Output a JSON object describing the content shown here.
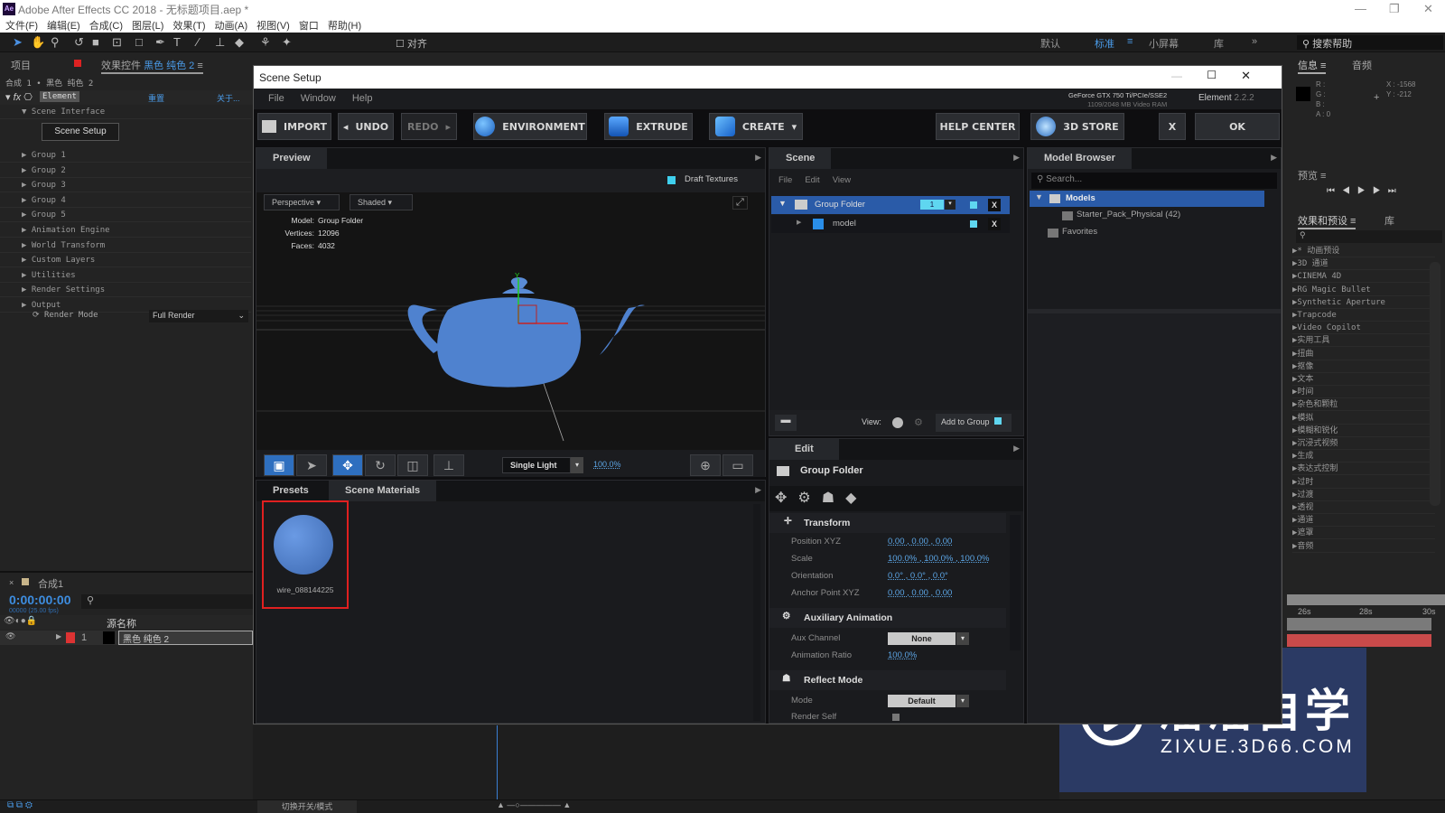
{
  "app": {
    "title": "Adobe After Effects CC 2018 - 无标题项目.aep *",
    "icon_text": "Ae",
    "menu": [
      "文件(F)",
      "编辑(E)",
      "合成(C)",
      "图层(L)",
      "效果(T)",
      "动画(A)",
      "视图(V)",
      "窗口",
      "帮助(H)"
    ],
    "snap_label": "对齐",
    "workspaces": [
      "默认",
      "标准",
      "小屏幕",
      "库"
    ],
    "active_workspace": "标准",
    "help_search": "搜索帮助"
  },
  "left": {
    "tab_project": "项目",
    "tab_effects": "效果控件",
    "layer_name": "黑色 纯色 2",
    "breadcrumb": "合成 1 • 黑色 纯色 2",
    "effect_name": "Element",
    "reset": "重置",
    "about": "关于...",
    "scene_interface": "Scene Interface",
    "scene_setup_btn": "Scene Setup",
    "groups": [
      "Group 1",
      "Group 2",
      "Group 3",
      "Group 4",
      "Group 5",
      "Animation Engine",
      "World Transform",
      "Custom Layers",
      "Utilities",
      "Render Settings",
      "Output"
    ],
    "render_mode_label": "Render Mode",
    "render_mode_value": "Full Render"
  },
  "timeline": {
    "comp": "合成1",
    "timecode": "0:00:00:00",
    "fps": "00000 (25.00 fps)",
    "col_source": "源名称",
    "layer_num": "1",
    "layer_name": "黑色 纯色 2",
    "toggle_label": "切换开关/模式"
  },
  "dialog": {
    "title": "Scene Setup",
    "menu": [
      "File",
      "Window",
      "Help"
    ],
    "gpu": "GeForce GTX 750 Ti/PCIe/SSE2",
    "vram": "1109/2048 MB Video RAM",
    "element": "Element",
    "version": "2.2.2",
    "toolbar": {
      "import": "IMPORT",
      "undo": "UNDO",
      "redo": "REDO",
      "environment": "ENVIRONMENT",
      "extrude": "EXTRUDE",
      "create": "CREATE",
      "help": "HELP CENTER",
      "store": "3D STORE",
      "x": "X",
      "ok": "OK"
    },
    "preview": {
      "tab": "Preview",
      "draft": "Draft Textures",
      "view": "Perspective",
      "shading": "Shaded",
      "model_label": "Model:",
      "model": "Group Folder",
      "vert_label": "Vertices:",
      "vertices": "12096",
      "faces_label": "Faces:",
      "faces": "4032",
      "light": "Single Light",
      "zoom": "100.0%"
    },
    "presets": {
      "tab1": "Presets",
      "tab2": "Scene Materials",
      "material": "wire_088144225"
    },
    "scene": {
      "tab": "Scene",
      "menu": [
        "File",
        "Edit",
        "View"
      ],
      "group": "Group Folder",
      "group_num": "1",
      "model": "model",
      "view_label": "View:",
      "add_group": "Add to Group"
    },
    "edit": {
      "tab": "Edit",
      "title": "Group Folder",
      "transform": "Transform",
      "rows": [
        {
          "label": "Position XYZ",
          "value": "0.00 ,  0.00 ,  0.00"
        },
        {
          "label": "Scale",
          "value": "100.0% ,  100.0% ,  100.0%"
        },
        {
          "label": "Orientation",
          "value": "0.0° ,  0.0° ,  0.0°"
        },
        {
          "label": "Anchor Point XYZ",
          "value": "0.00 ,  0.00 ,  0.00"
        }
      ],
      "aux": "Auxiliary Animation",
      "aux_channel": "Aux Channel",
      "aux_value": "None",
      "anim_ratio": "Animation Ratio",
      "anim_ratio_value": "100.0%",
      "reflect": "Reflect Mode",
      "mode": "Mode",
      "mode_value": "Default",
      "render_self": "Render Self"
    },
    "browser": {
      "tab": "Model Browser",
      "search_placeholder": "Search...",
      "models": "Models",
      "pack": "Starter_Pack_Physical (42)",
      "favorites": "Favorites"
    }
  },
  "right": {
    "info": "信息",
    "audio": "音频",
    "r": "R :",
    "g": "G :",
    "b": "B :",
    "a": "A : 0",
    "x": "X : -1568",
    "y": "Y : -212",
    "preview": "预览",
    "effects": "效果和预设",
    "library": "库",
    "fx": [
      "* 动画预设",
      "3D 通道",
      "CINEMA 4D",
      "RG Magic Bullet",
      "Synthetic Aperture",
      "Trapcode",
      "Video Copilot",
      "实用工具",
      "扭曲",
      "抠像",
      "文本",
      "时间",
      "杂色和颗粒",
      "模拟",
      "模糊和锐化",
      "沉浸式视频",
      "生成",
      "表达式控制",
      "过时",
      "过渡",
      "透视",
      "通道",
      "遮罩",
      "音频"
    ],
    "ticks": [
      "26s",
      "28s",
      "30s"
    ]
  },
  "watermark": {
    "name": "溜溜自学",
    "url": "ZIXUE.3D66.COM"
  },
  "colors": {
    "accent": "#2e6fbf",
    "selection": "#2a5ba8",
    "teapot": "#4f82cf",
    "highlight": "#e02020",
    "watermark": "#2b3a64"
  }
}
